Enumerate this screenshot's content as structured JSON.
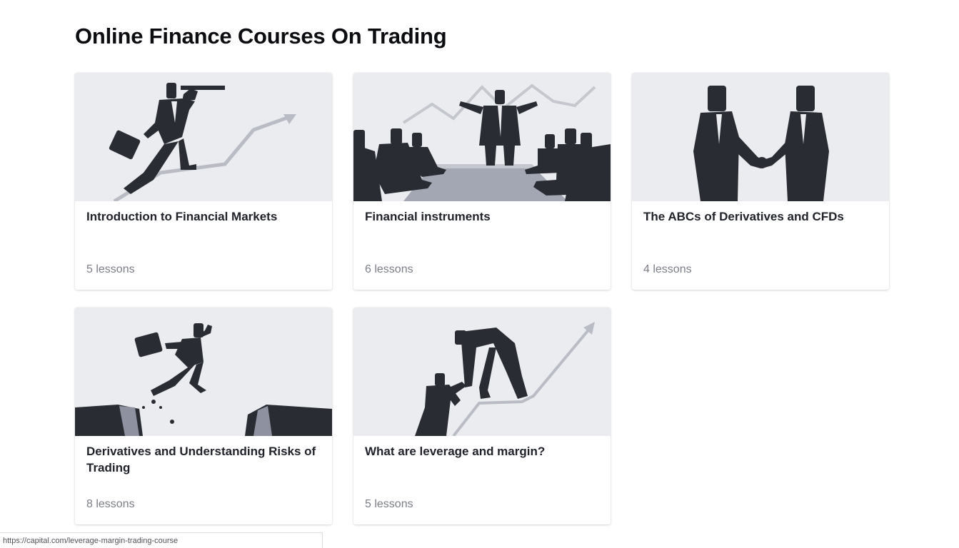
{
  "page": {
    "title": "Online Finance Courses On Trading"
  },
  "courses": [
    {
      "title": "Introduction to Financial Markets",
      "lessons": "5 lessons",
      "image_icon": "telescope-climber-icon"
    },
    {
      "title": "Financial instruments",
      "lessons": "6 lessons",
      "image_icon": "meeting-room-icon"
    },
    {
      "title": "The ABCs of Derivatives and CFDs",
      "lessons": "4 lessons",
      "image_icon": "handshake-icon"
    },
    {
      "title": "Derivatives and Understanding Risks of Trading",
      "lessons": "8 lessons",
      "image_icon": "gap-jumper-icon"
    },
    {
      "title": "What are leverage and margin?",
      "lessons": "5 lessons",
      "image_icon": "helping-hand-icon"
    }
  ],
  "status_bar": {
    "url": "https://capital.com/leverage-margin-trading-course"
  },
  "colors": {
    "image_background": "#ebecef",
    "figure": "#2a2c34",
    "trend_line": "#b9bcc5",
    "lessons_text": "#7b7e87"
  }
}
